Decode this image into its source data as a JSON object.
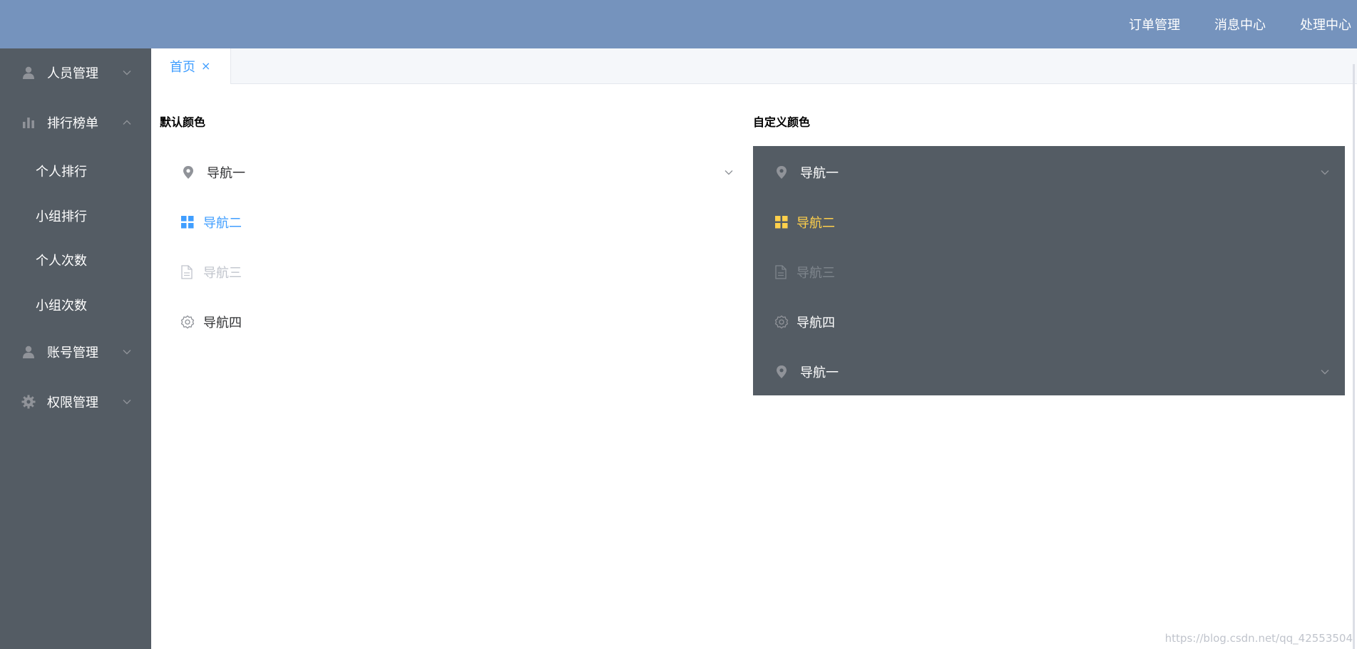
{
  "header": {
    "bg_color": "#7593bd",
    "nav": [
      {
        "label": "订单管理",
        "icon": ""
      },
      {
        "label": "消息中心",
        "icon": ""
      },
      {
        "label": "处理中心",
        "icon": ""
      }
    ]
  },
  "sidebar": {
    "bg_color": "#545c64",
    "groups": [
      {
        "label": "人员管理",
        "icon": "user-icon",
        "expanded": false
      },
      {
        "label": "排行榜单",
        "icon": "bar-chart-icon",
        "expanded": true,
        "children": [
          "个人排行",
          "小组排行",
          "个人次数",
          "小组次数"
        ]
      },
      {
        "label": "账号管理",
        "icon": "user-icon",
        "expanded": false
      },
      {
        "label": "权限管理",
        "icon": "gear-icon",
        "expanded": false
      }
    ]
  },
  "tabs": [
    {
      "label": "首页",
      "close": "×",
      "active": true
    }
  ],
  "content": {
    "default_title": "默认颜色",
    "custom_title": "自定义颜色",
    "default_menu": {
      "bg_color": "#ffffff",
      "text_color": "#303133",
      "active_color": "#409eff",
      "disabled_color": "#c0c4cc",
      "items": [
        {
          "label": "导航一",
          "icon": "location-icon",
          "state": "normal",
          "submenu": true
        },
        {
          "label": "导航二",
          "icon": "grid-menu-icon",
          "state": "active"
        },
        {
          "label": "导航三",
          "icon": "document-icon",
          "state": "disabled"
        },
        {
          "label": "导航四",
          "icon": "setting-icon",
          "state": "normal"
        }
      ]
    },
    "custom_menu": {
      "bg_color": "#545c64",
      "text_color": "#ffffff",
      "active_color": "#ffd04b",
      "disabled_color": "#7f868d",
      "items": [
        {
          "label": "导航一",
          "icon": "location-icon",
          "state": "normal",
          "submenu": true
        },
        {
          "label": "导航二",
          "icon": "grid-menu-icon",
          "state": "active"
        },
        {
          "label": "导航三",
          "icon": "document-icon",
          "state": "disabled"
        },
        {
          "label": "导航四",
          "icon": "setting-icon",
          "state": "normal"
        },
        {
          "label": "导航一",
          "icon": "location-icon",
          "state": "normal",
          "submenu": true
        }
      ]
    }
  },
  "watermark": "https://blog.csdn.net/qq_42553504"
}
